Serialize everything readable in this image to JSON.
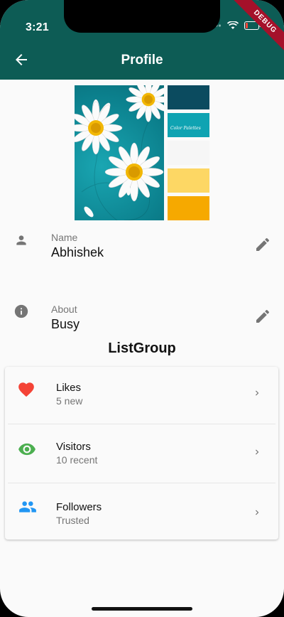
{
  "status_bar": {
    "time": "3:21"
  },
  "debug_banner": "DEBUG",
  "app_bar": {
    "title": "Profile"
  },
  "hero_image": {
    "palette_label": "Color Palettes",
    "colors": [
      "#0b4b5f",
      "#0fa3b2",
      "#f6f6f6",
      "#fdd764",
      "#f6a900"
    ]
  },
  "profile": {
    "name_label": "Name",
    "name_value": "Abhishek",
    "about_label": "About",
    "about_value": "Busy"
  },
  "section_title": "ListGroup",
  "list": [
    {
      "title": "Likes",
      "subtitle": "5 new",
      "icon": "heart-icon",
      "color": "#f44336"
    },
    {
      "title": "Visitors",
      "subtitle": "10 recent",
      "icon": "eye-icon",
      "color": "#4caf50"
    },
    {
      "title": "Followers",
      "subtitle": "Trusted",
      "icon": "people-icon",
      "color": "#2196f3"
    }
  ],
  "colors": {
    "app_bar": "#0d5c55",
    "background": "#fafafa",
    "icon_grey": "#757575"
  }
}
